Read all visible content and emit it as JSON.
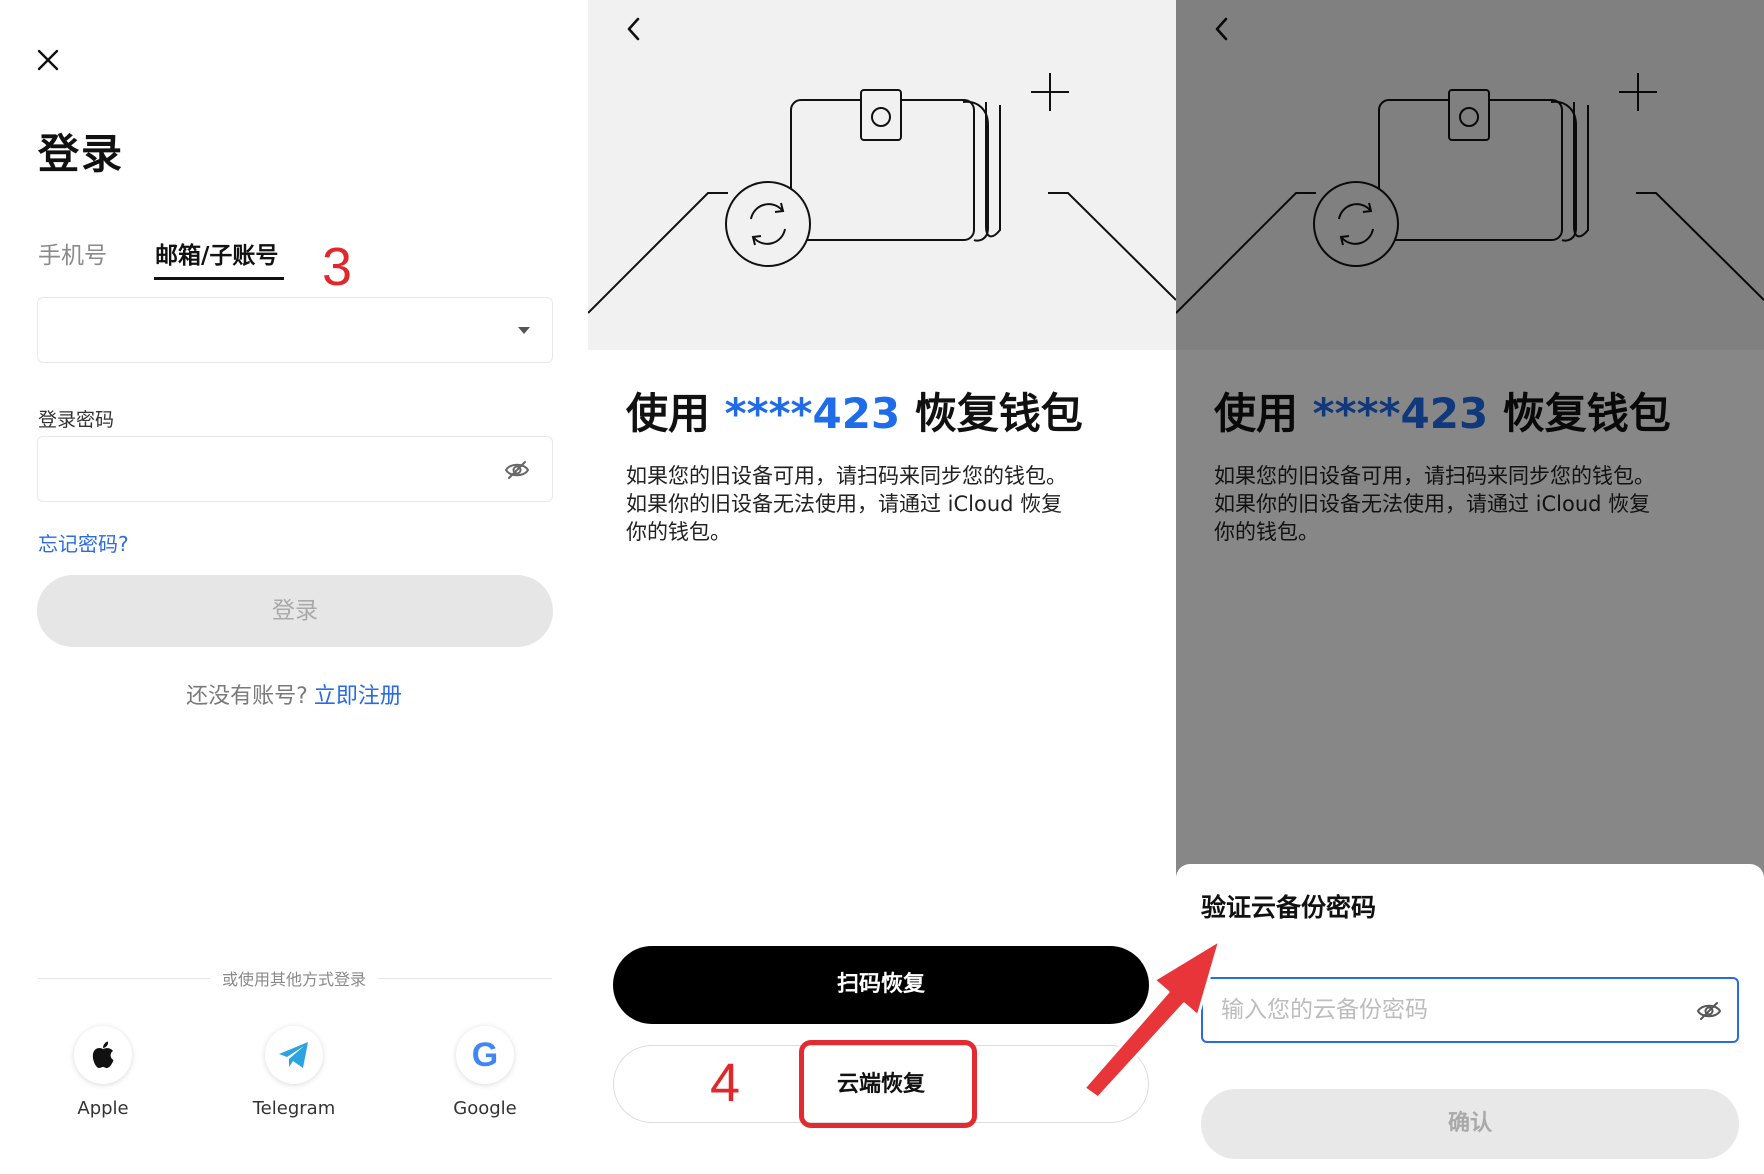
{
  "login": {
    "title": "登录",
    "tabs": [
      "手机号",
      "邮箱/子账号"
    ],
    "annotation": "3",
    "password_label": "登录密码",
    "forgot": "忘记密码?",
    "login_button": "登录",
    "no_account": "还没有账号?",
    "register": "立即注册",
    "other_methods": "或使用其他方式登录",
    "social": [
      "Apple",
      "Telegram",
      "Google"
    ]
  },
  "restore": {
    "title_prefix": "使用",
    "masked_account": "****423",
    "title_suffix": "恢复钱包",
    "desc_lines": [
      "如果您的旧设备可用，请扫码来同步您的钱包。",
      "如果你的旧设备无法使用，请通过 iCloud 恢复",
      "你的钱包。"
    ],
    "scan_button": "扫码恢复",
    "cloud_button": "云端恢复",
    "annotation": "4"
  },
  "verify": {
    "sheet_title": "验证云备份密码",
    "placeholder": "输入您的云备份密码",
    "confirm": "确认"
  },
  "colors": {
    "accent": "#2a6be5",
    "annotation_red": "#e22b30"
  }
}
